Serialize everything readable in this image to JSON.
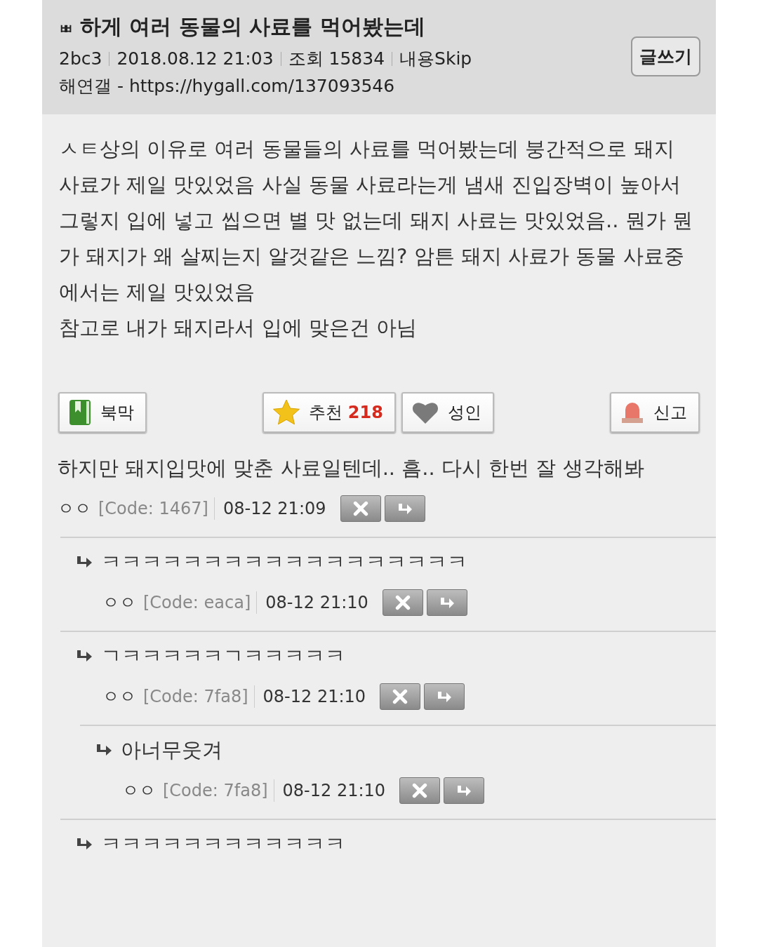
{
  "post": {
    "title_prefix": "ㅃ",
    "title": "하게 여러 동물의 사료를 먹어봤는데",
    "meta": [
      "2bc3",
      "2018.08.12 21:03",
      "조회 15834",
      "내용Skip"
    ],
    "source": "해연갤 - https://hygall.com/137093546",
    "write_button": "글쓰기",
    "body": [
      "ㅅㅌ상의 이유로 여러 동물들의 사료를 먹어봤는데 붕간적으로 돼지 사료가 제일 맛있었음 사실 동물 사료라는게 냄새 진입장벽이 높아서 그렇지 입에 넣고 씹으면 별 맛 없는데 돼지 사료는 맛있었음.. 뭔가 뭔가 돼지가 왜 살찌는지 알것같은 느낌? 암튼 돼지 사료가 동물 사료중에서는 제일 맛있었음",
      "참고로 내가 돼지라서 입에 맞은건 아님"
    ]
  },
  "actions": [
    {
      "kind": "bookmark",
      "label": "북막"
    },
    {
      "kind": "recommend",
      "label": "추천",
      "count": "218"
    },
    {
      "kind": "adult",
      "label": "성인"
    },
    {
      "kind": "report",
      "label": "신고"
    }
  ],
  "comments": [
    {
      "text": "하지만 돼지입맛에 맞춘 사료일텐데.. 흠.. 다시 한번 잘 생각해봐",
      "author": "ㅇㅇ",
      "code": "[Code: 1467]",
      "time": "08-12 21:09",
      "children": [
        {
          "text": "ㅋㅋㅋㅋㅋㅋㅋㅋㅋㅋㅋㅋㅋㅋㅋㅋㅋㅋ",
          "author": "ㅇㅇ",
          "code": "[Code: eaca]",
          "time": "08-12 21:10"
        },
        {
          "text": "ㄱㅋㅋㅋㅋㅋㄱㅋㅋㅋㅋㅋ",
          "author": "ㅇㅇ",
          "code": "[Code: 7fa8]",
          "time": "08-12 21:10",
          "children": [
            {
              "text": "아너무웃겨",
              "author": "ㅇㅇ",
              "code": "[Code: 7fa8]",
              "time": "08-12 21:10"
            }
          ]
        },
        {
          "text": "ㅋㅋㅋㅋㅋㅋㅋㅋㅋㅋㅋㅋ"
        }
      ]
    }
  ]
}
